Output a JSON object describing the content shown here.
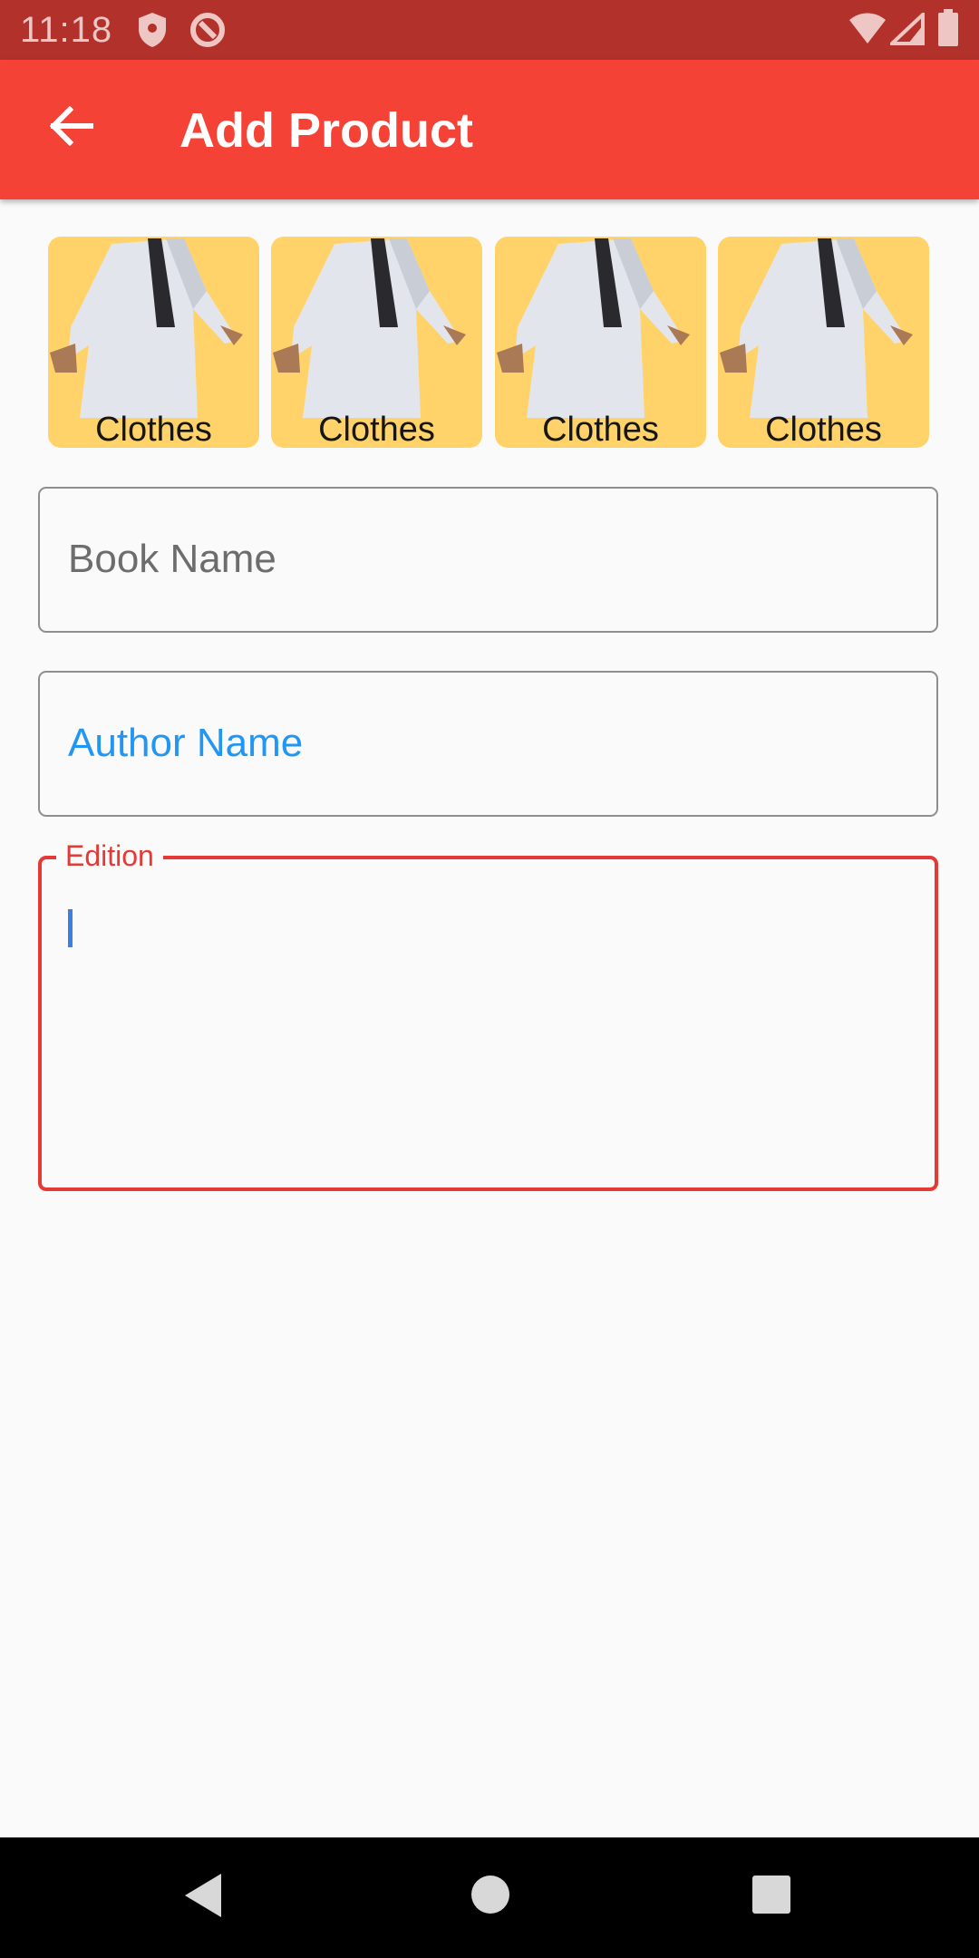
{
  "status_bar": {
    "time": "11:18",
    "icons": [
      "shield-icon",
      "at-sign-icon",
      "wifi-icon",
      "signal-icon",
      "battery-icon"
    ]
  },
  "app_bar": {
    "title": "Add Product",
    "back_icon": "arrow-left-icon",
    "color": "#f44336"
  },
  "categories": [
    {
      "label": "Clothes"
    },
    {
      "label": "Clothes"
    },
    {
      "label": "Clothes"
    },
    {
      "label": "Clothes"
    }
  ],
  "form": {
    "book_name": {
      "placeholder": "Book Name",
      "value": ""
    },
    "author_name": {
      "placeholder": "Author Name",
      "value": ""
    },
    "edition": {
      "label": "Edition",
      "value": "",
      "state": "focused-error"
    }
  },
  "colors": {
    "accent_red": "#f44336",
    "error_red": "#e53935",
    "link_blue": "#2196f3",
    "thumb_bg": "#ffd369"
  },
  "navigation_bar": {
    "icons": [
      "back-triangle-icon",
      "home-circle-icon",
      "recents-square-icon"
    ]
  }
}
